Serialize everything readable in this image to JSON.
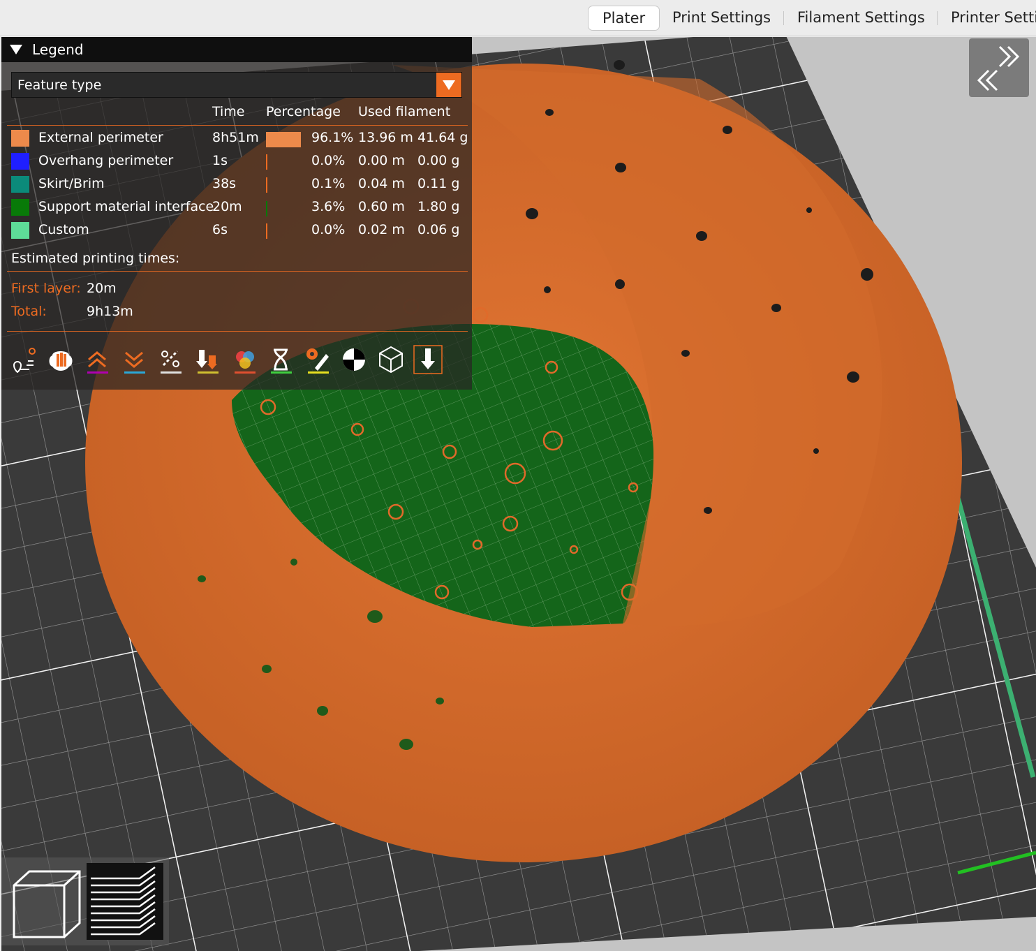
{
  "tabs": [
    {
      "label": "Plater",
      "active": true
    },
    {
      "label": "Print Settings",
      "active": false
    },
    {
      "label": "Filament Settings",
      "active": false
    },
    {
      "label": "Printer Setti",
      "active": false
    }
  ],
  "legend": {
    "title": "Legend",
    "view_type": "Feature type",
    "columns": {
      "time": "Time",
      "percentage": "Percentage",
      "used_filament": "Used filament"
    },
    "rows": [
      {
        "name": "External perimeter",
        "color": "#ED8A4B",
        "time": "8h51m",
        "percent_value": 96.1,
        "percent": "96.1%",
        "length": "13.96 m",
        "weight": "41.64 g"
      },
      {
        "name": "Overhang perimeter",
        "color": "#1F1FFF",
        "time": "1s",
        "percent_value": 0.0,
        "percent": "0.0%",
        "length": "0.00 m",
        "weight": "0.00 g"
      },
      {
        "name": "Skirt/Brim",
        "color": "#0B8A7A",
        "time": "38s",
        "percent_value": 0.1,
        "percent": "0.1%",
        "length": "0.04 m",
        "weight": "0.11 g"
      },
      {
        "name": "Support material interface",
        "color": "#087A08",
        "time": "20m",
        "percent_value": 3.6,
        "percent": "3.6%",
        "length": "0.60 m",
        "weight": "1.80 g"
      },
      {
        "name": "Custom",
        "color": "#5EDC98",
        "time": "6s",
        "percent_value": 0.0,
        "percent": "0.0%",
        "length": "0.02 m",
        "weight": "0.06 g"
      }
    ],
    "estimated_title": "Estimated printing times:",
    "first_layer_label": "First layer:",
    "first_layer_value": "20m",
    "total_label": "Total:",
    "total_value": "9h13m"
  },
  "toolbar_icons": [
    {
      "name": "travel-icon",
      "underline": ""
    },
    {
      "name": "wipe-hand-icon",
      "underline": ""
    },
    {
      "name": "retractions-icon",
      "underline": "#b000b0"
    },
    {
      "name": "deretractions-icon",
      "underline": "#2aa8d8"
    },
    {
      "name": "seams-icon",
      "underline": "#e0e0e0"
    },
    {
      "name": "tool-changes-icon",
      "underline": "#d0c030"
    },
    {
      "name": "color-changes-icon",
      "underline": "#e05030"
    },
    {
      "name": "pause-prints-icon",
      "underline": "#40d040"
    },
    {
      "name": "custom-gcodes-icon",
      "underline": "#e8e020"
    },
    {
      "name": "center-of-gravity-icon",
      "underline": ""
    },
    {
      "name": "shells-icon",
      "underline": ""
    },
    {
      "name": "tool-marker-icon",
      "underline": ""
    }
  ],
  "colors": {
    "accent": "#ED6B21",
    "model": "#D2692C",
    "support": "#156B17",
    "bed": "#3A3A3A"
  }
}
